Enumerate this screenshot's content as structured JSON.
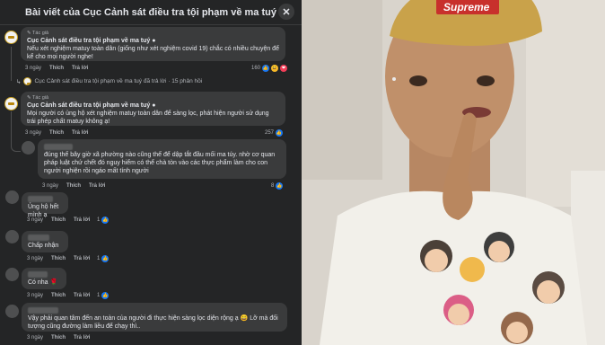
{
  "header": {
    "title": "Bài viết của Cục Cảnh sát điều tra tội phạm về ma tuý",
    "close": "✕"
  },
  "comments": [
    {
      "badge": "✎ Tác giả",
      "author": "Cục Cảnh sát điều tra tội phạm về ma tuý ●",
      "text": "Nếu xét nghiệm matuy toàn dân (giống như xét nghiệm covid 19) chắc có nhiều chuyện để kể cho mọi người nghe!",
      "time": "3 ngày",
      "like": "Thích",
      "reply": "Trả lời",
      "count": "160"
    },
    {
      "reply_summary": "Cục Cảnh sát điều tra tội phạm về ma tuý đã trả lời · 15 phản hồi"
    },
    {
      "badge": "✎ Tác giả",
      "author": "Cục Cảnh sát điều tra tội phạm về ma tuý ●",
      "text": "Mọi người có ủng hộ xét nghiệm matuy toàn dân để sàng lọc, phát hiện người sử dụng trái phép chất matuy không ạ!",
      "time": "3 ngày",
      "like": "Thích",
      "reply": "Trả lời",
      "count": "257"
    },
    {
      "text": "đúng thế bây giờ xã phường nào cũng thế để dập tắt đầu mối ma túy. nhờ cơ quan pháp luật chứ chết đó nguy hiểm có thể chà tòn vào các thực phẩm làm cho con người nghiện rồi ngáo mất tính người",
      "time": "3 ngày",
      "like": "Thích",
      "reply": "Trả lời",
      "count": "8"
    },
    {
      "text": "Ủng hộ hết mình ạ",
      "time": "3 ngày",
      "like": "Thích",
      "reply": "Trả lời",
      "count": "1"
    },
    {
      "text": "Chấp nhận",
      "time": "3 ngày",
      "like": "Thích",
      "reply": "Trả lời",
      "count": "1"
    },
    {
      "text": "Có nha 🌹",
      "time": "3 ngày",
      "like": "Thích",
      "reply": "Trả lời",
      "count": "1"
    },
    {
      "text": "Vậy phải quan tâm đến an toàn của người đi thực hiện sàng lọc diện rộng ạ 😄 Lỡ mà đối tượng cũng đường làm liều để chạy thì..",
      "time": "3 ngày",
      "like": "Thích",
      "reply": "Trả lời"
    }
  ],
  "photo": {
    "cap_text": "Supreme",
    "colors": {
      "cap": "#c9a24a",
      "shirt": "#f2f0ea",
      "bg": "#d9d4cc"
    }
  }
}
